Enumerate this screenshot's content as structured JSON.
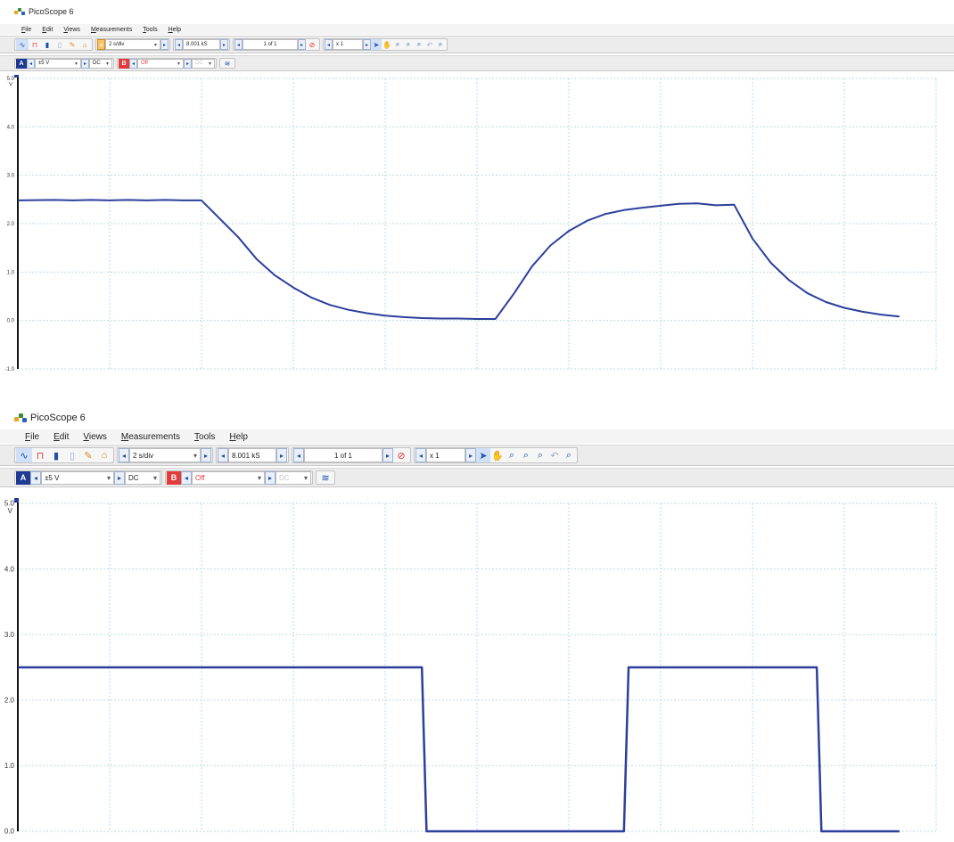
{
  "screens": [
    {
      "app_title": "PicoScope 6",
      "menu": [
        {
          "pre": "",
          "ul": "F",
          "post": "ile"
        },
        {
          "pre": "",
          "ul": "E",
          "post": "dit"
        },
        {
          "pre": "",
          "ul": "V",
          "post": "iews"
        },
        {
          "pre": "",
          "ul": "M",
          "post": "easurements"
        },
        {
          "pre": "",
          "ul": "T",
          "post": "ools"
        },
        {
          "pre": "",
          "ul": "H",
          "post": "elp"
        }
      ],
      "timebase": "2 s/div",
      "samples": "8.001 kS",
      "page": "1 of 1",
      "zoom": "x 1",
      "channel_a": {
        "label": "A",
        "range": "±5 V",
        "coupling": "DC"
      },
      "channel_b": {
        "label": "B",
        "range": "Off",
        "coupling": "DC"
      },
      "y_unit": "V",
      "y_ticks": [
        "5.0",
        "4.0",
        "3.0",
        "2.0",
        "1.0",
        "0.0",
        "-1.0"
      ]
    },
    {
      "app_title": "PicoScope 6",
      "menu": [
        {
          "pre": "",
          "ul": "F",
          "post": "ile"
        },
        {
          "pre": "",
          "ul": "E",
          "post": "dit"
        },
        {
          "pre": "",
          "ul": "V",
          "post": "iews"
        },
        {
          "pre": "",
          "ul": "M",
          "post": "easurements"
        },
        {
          "pre": "",
          "ul": "T",
          "post": "ools"
        },
        {
          "pre": "",
          "ul": "H",
          "post": "elp"
        }
      ],
      "timebase": "2 s/div",
      "samples": "8.001 kS",
      "page": "1 of 1",
      "zoom": "x 1",
      "channel_a": {
        "label": "A",
        "range": "±5 V",
        "coupling": "DC"
      },
      "channel_b": {
        "label": "B",
        "range": "Off",
        "coupling": "DC"
      },
      "y_unit": "V",
      "y_ticks": [
        "5.0",
        "4.0",
        "3.0",
        "2.0",
        "1.0",
        "0.0"
      ]
    }
  ],
  "colors": {
    "trace": "#2b3f9c",
    "grid": "#b9dbe8",
    "channel_a": "#1f3a93",
    "channel_b": "#e23b3b",
    "axis": "#111111"
  },
  "chart_data": [
    {
      "type": "line",
      "title": "",
      "xlabel": "",
      "ylabel": "V",
      "ylim": [
        -1.0,
        5.0
      ],
      "x_divisions": 10,
      "y_ticks": [
        5.0,
        4.0,
        3.0,
        2.0,
        1.0,
        0.0,
        -1.0
      ],
      "series": [
        {
          "x": [
            0.0,
            0.4,
            0.6,
            0.8,
            1.0,
            1.2,
            1.4,
            1.6,
            1.8,
            2.0,
            2.4,
            2.6,
            2.8,
            3.0,
            3.2,
            3.4,
            3.6,
            3.8,
            4.0,
            4.2,
            4.4,
            4.6,
            4.8,
            5.0,
            5.2,
            5.4,
            5.6,
            5.8,
            6.0,
            6.2,
            6.4,
            6.6,
            6.8,
            7.0,
            7.2,
            7.4,
            7.6,
            7.8,
            8.0,
            8.2,
            8.4,
            8.6,
            8.8,
            9.0,
            9.2,
            9.4,
            9.6
          ],
          "y": [
            2.48,
            2.49,
            2.48,
            2.49,
            2.48,
            2.49,
            2.48,
            2.49,
            2.48,
            2.48,
            1.72,
            1.27,
            0.93,
            0.68,
            0.47,
            0.32,
            0.22,
            0.15,
            0.1,
            0.07,
            0.05,
            0.04,
            0.04,
            0.03,
            0.03,
            0.55,
            1.12,
            1.55,
            1.85,
            2.06,
            2.2,
            2.28,
            2.33,
            2.37,
            2.41,
            2.42,
            2.38,
            2.39,
            1.69,
            1.19,
            0.83,
            0.56,
            0.38,
            0.26,
            0.18,
            0.12,
            0.08
          ]
        }
      ]
    },
    {
      "type": "line",
      "title": "",
      "xlabel": "",
      "ylabel": "V",
      "ylim": [
        0.0,
        5.0
      ],
      "x_divisions": 10,
      "y_ticks": [
        5.0,
        4.0,
        3.0,
        2.0,
        1.0,
        0.0
      ],
      "series": [
        {
          "x": [
            0.0,
            2.2,
            4.4,
            4.45,
            6.6,
            6.65,
            8.7,
            8.75,
            9.6
          ],
          "y": [
            2.5,
            2.5,
            2.5,
            0.0,
            0.0,
            2.5,
            2.5,
            0.0,
            0.0
          ]
        }
      ]
    }
  ]
}
